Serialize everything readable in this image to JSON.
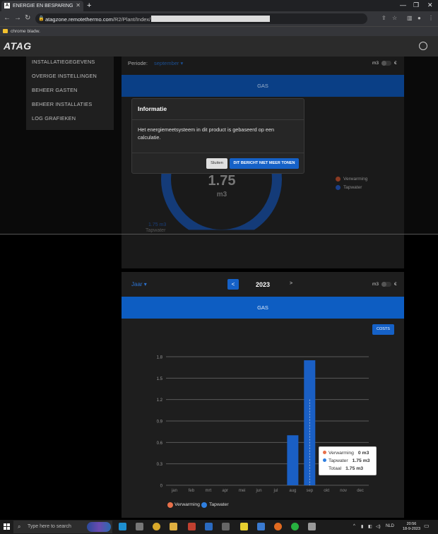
{
  "browser": {
    "tab_title": "ENERGIE EN BESPARING",
    "url_host": "atagzone.remotethermo.com",
    "url_path": "/R2/Plant/Index/",
    "bookmark": "chrome bladw."
  },
  "app": {
    "logo": "ATAG",
    "menu": [
      "INSTALLATIEGEGEVENS",
      "OVERIGE INSTELLINGEN",
      "BEHEER GASTEN",
      "BEHEER INSTALLATIES",
      "LOG GRAFIEKEN"
    ]
  },
  "top_panel": {
    "periode_label": "Periode:",
    "periode_value": "september ▾",
    "unit_left": "m3",
    "unit_right": "€",
    "gas_title": "GAS",
    "ring_value": "1.75",
    "ring_unit": "m3",
    "legend": [
      {
        "label": "Verwarming",
        "color": "#c0512f"
      },
      {
        "label": "Tapwater",
        "color": "#1a3f8a"
      }
    ],
    "tap_value": "1.75 m3",
    "tap_label": "Tapwater"
  },
  "modal": {
    "title": "Informatie",
    "body": "Het energiemeetsysteem in dit product is gebaseerd op een calculatie.",
    "close_label": "Sluiten",
    "dont_show_label": "DIT BERICHT NIET MEER TONEN"
  },
  "bottom_panel": {
    "period_select": "Jaar ▾",
    "prev_label": "<",
    "year": "2023",
    "next_label": ">",
    "unit_left": "m3",
    "unit_right": "€",
    "gas_title": "GAS",
    "costs_label": "COSTS",
    "legend": [
      {
        "label": "Verwarming",
        "color": "#e8704a"
      },
      {
        "label": "Tapwater",
        "color": "#2f7fe0"
      }
    ],
    "tooltip": {
      "rows": [
        {
          "label": "Verwarming",
          "value": "0 m3",
          "color": "#e8704a"
        },
        {
          "label": "Tapwater",
          "value": "1.75 m3",
          "color": "#2f7fe0"
        },
        {
          "label": "Totaal",
          "value": "1.75 m3",
          "color": ""
        }
      ]
    }
  },
  "chart_data": {
    "type": "bar",
    "categories": [
      "jan",
      "feb",
      "mrt",
      "apr",
      "mei",
      "jun",
      "jul",
      "aug",
      "sep",
      "okt",
      "nov",
      "dec"
    ],
    "series": [
      {
        "name": "Verwarming",
        "values": [
          0,
          0,
          0,
          0,
          0,
          0,
          0,
          0,
          0,
          0,
          0,
          0
        ]
      },
      {
        "name": "Tapwater",
        "values": [
          0,
          0,
          0,
          0,
          0,
          0,
          0,
          0.7,
          1.75,
          0,
          0,
          0
        ]
      }
    ],
    "yticks": [
      "0",
      "0.3",
      "0.6",
      "0.9",
      "1.2",
      "1.5",
      "1.8"
    ],
    "ylim": [
      0,
      1.8
    ],
    "grid": true,
    "legend": "bottom",
    "colors": {
      "bar": "#1a5fc4"
    }
  },
  "taskbar": {
    "search_placeholder": "Type here to search",
    "lang": "NLD",
    "time": "20:56",
    "date": "18-9-2023"
  }
}
